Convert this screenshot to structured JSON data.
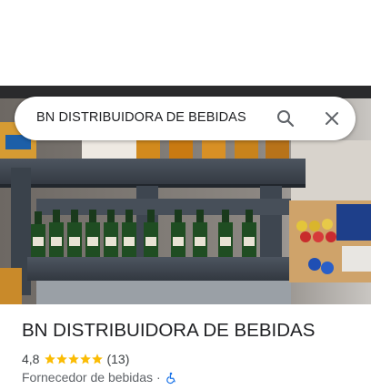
{
  "search": {
    "query": "BN DISTRIBUIDORA DE BEBIDAS"
  },
  "place": {
    "name": "BN DISTRIBUIDORA DE BEBIDAS",
    "rating": "4,8",
    "stars": 5,
    "review_count": "(13)",
    "category": "Fornecedor de bebidas",
    "separator": "·"
  },
  "colors": {
    "star": "#fbbc04",
    "accessible_icon": "#1a73e8",
    "text_primary": "#202124",
    "text_secondary": "#5f6368"
  },
  "icons": {
    "search": "search-icon",
    "close": "close-icon",
    "accessible": "wheelchair-icon"
  }
}
